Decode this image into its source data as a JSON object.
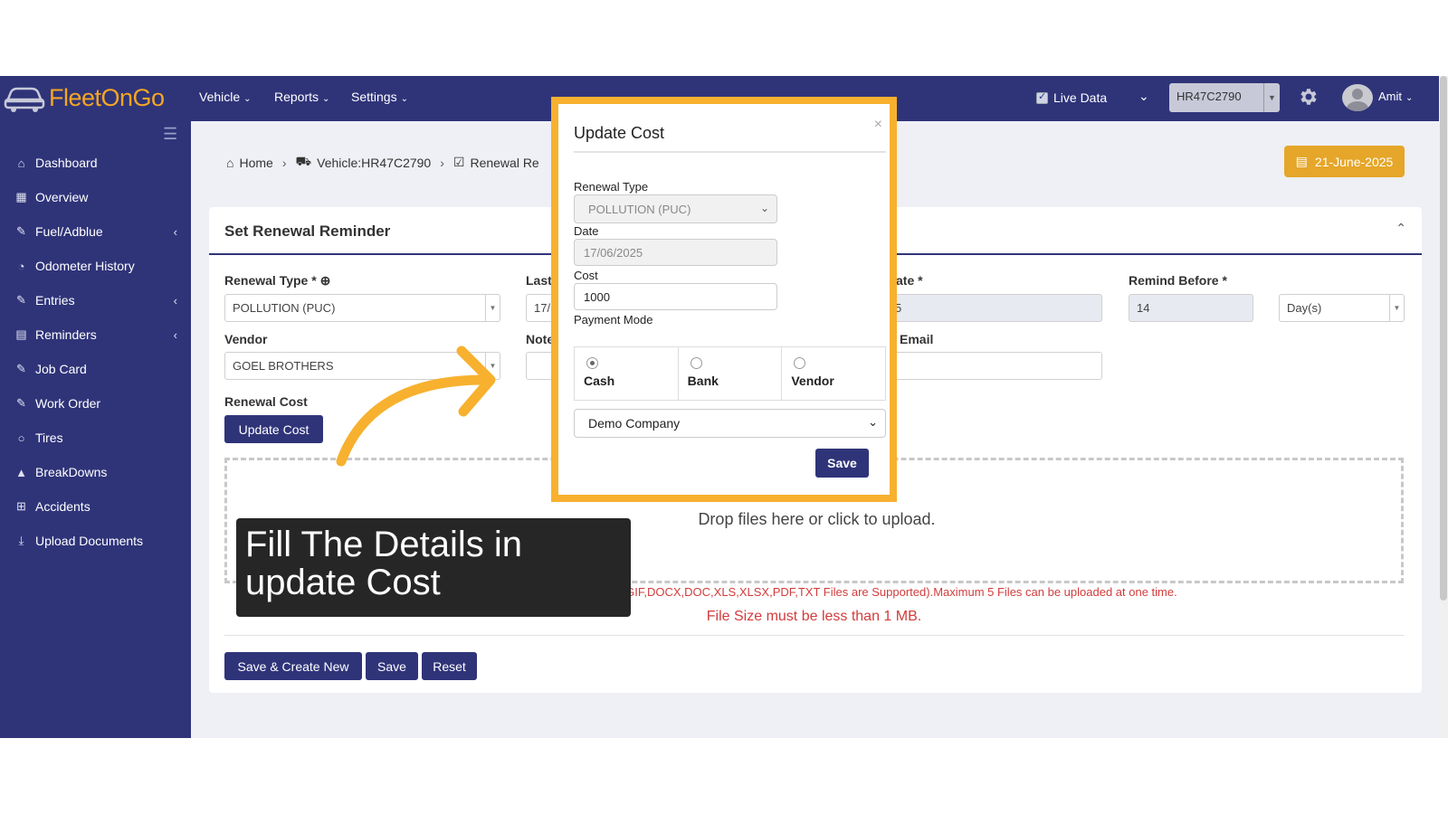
{
  "app": {
    "logo_text": "FleetOnGo"
  },
  "topnav": {
    "menus": [
      "Vehicle",
      "Reports",
      "Settings"
    ],
    "live_data_label": "Live Data",
    "vehicle_selected": "HR47C2790",
    "user_name": "Amit"
  },
  "sidebar": {
    "items": [
      {
        "label": "Dashboard",
        "icon": "home-icon"
      },
      {
        "label": "Overview",
        "icon": "grid-icon"
      },
      {
        "label": "Fuel/Adblue",
        "icon": "edit-icon"
      },
      {
        "label": "Odometer History",
        "icon": "gauge-icon"
      },
      {
        "label": "Entries",
        "icon": "edit-icon"
      },
      {
        "label": "Reminders",
        "icon": "calendar-icon"
      },
      {
        "label": "Job Card",
        "icon": "edit-icon"
      },
      {
        "label": "Work Order",
        "icon": "edit-icon"
      },
      {
        "label": "Tires",
        "icon": "circle-icon"
      },
      {
        "label": "BreakDowns",
        "icon": "warning-icon"
      },
      {
        "label": "Accidents",
        "icon": "plus-square-icon"
      },
      {
        "label": "Upload Documents",
        "icon": "download-icon"
      }
    ]
  },
  "breadcrumb": {
    "home": "Home",
    "vehicle": "Vehicle:HR47C2790",
    "current": "Renewal Re"
  },
  "date_button": "21-June-2025",
  "form": {
    "title": "Set Renewal Reminder",
    "renewal_type_label": "Renewal Type *",
    "renewal_type_value": "POLLUTION (PUC)",
    "last_label": "Last",
    "last_value": "17/",
    "date_label_partial": "ate *",
    "date_value_partial": "5",
    "remind_before_label": "Remind Before *",
    "remind_before_value": "14",
    "remind_unit": "Day(s)",
    "vendor_label": "Vendor",
    "vendor_value": "GOEL BROTHERS",
    "note_label": "Note",
    "email_label": "Email",
    "renewal_cost_label": "Renewal Cost",
    "update_cost_button": "Update Cost",
    "dropzone_text": "Drop files here or click to upload.",
    "warning_text": "ents Here (Only PNG,JPG,JPEG,GIF,DOCX,DOC,XLS,XLSX,PDF,TXT Files are Supported).Maximum 5 Files can be uploaded at one time.",
    "size_warning": "File Size must be less than 1 MB.",
    "buttons": {
      "save_create": "Save & Create New",
      "save": "Save",
      "reset": "Reset"
    }
  },
  "modal": {
    "title": "Update Cost",
    "close": "×",
    "renewal_type_label": "Renewal Type",
    "renewal_type_value": "POLLUTION (PUC)",
    "date_label": "Date",
    "date_value": "17/06/2025",
    "cost_label": "Cost",
    "cost_value": "1000",
    "payment_mode_label": "Payment Mode",
    "payment_modes": [
      "Cash",
      "Bank",
      "Vendor"
    ],
    "selected_mode": "Cash",
    "company_value": "Demo Company",
    "save_button": "Save"
  },
  "annotation": {
    "text": "Fill The Details in update Cost",
    "arrow_color": "#f7b12f"
  },
  "colors": {
    "navbar": "#2f3479",
    "accent": "#f5a623",
    "highlight_border": "#f7b12f",
    "danger": "#d23c3c"
  }
}
